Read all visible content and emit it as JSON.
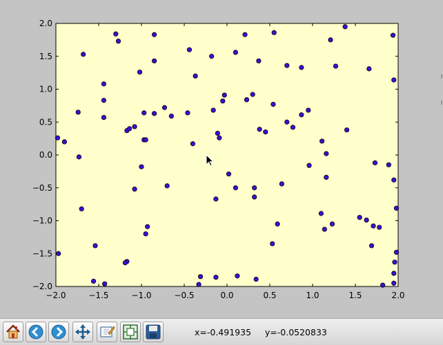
{
  "chart_data": {
    "type": "scatter",
    "xlim": [
      -2.0,
      2.0
    ],
    "ylim": [
      -2.0,
      2.0
    ],
    "x_ticks": [
      "−2.0",
      "−1.5",
      "−1.0",
      "−0.5",
      "0.0",
      "0.5",
      "1.0",
      "1.5",
      "2.0"
    ],
    "y_ticks": [
      "−2.0",
      "−1.5",
      "−1.0",
      "−0.5",
      "0.0",
      "0.5",
      "1.0",
      "1.5",
      "2.0"
    ],
    "grid": false,
    "marker_color": "#3d10d6",
    "marker_edge": "#000000",
    "background": "#ffffcc",
    "points": [
      [
        -1.3,
        1.84
      ],
      [
        -1.27,
        1.73
      ],
      [
        -0.85,
        1.83
      ],
      [
        -1.68,
        1.53
      ],
      [
        -0.44,
        1.6
      ],
      [
        -0.18,
        1.5
      ],
      [
        0.1,
        1.56
      ],
      [
        0.21,
        1.83
      ],
      [
        0.55,
        1.86
      ],
      [
        0.37,
        1.43
      ],
      [
        0.7,
        1.36
      ],
      [
        0.87,
        1.33
      ],
      [
        1.21,
        1.75
      ],
      [
        1.38,
        1.95
      ],
      [
        1.27,
        1.35
      ],
      [
        1.66,
        1.31
      ],
      [
        1.94,
        1.82
      ],
      [
        1.95,
        1.14
      ],
      [
        -0.85,
        1.43
      ],
      [
        -1.02,
        1.26
      ],
      [
        -0.37,
        1.2
      ],
      [
        -1.44,
        1.08
      ],
      [
        -1.44,
        0.83
      ],
      [
        -1.44,
        0.57
      ],
      [
        -1.74,
        0.65
      ],
      [
        -0.97,
        0.64
      ],
      [
        -0.85,
        0.63
      ],
      [
        -0.73,
        0.72
      ],
      [
        -0.65,
        0.59
      ],
      [
        -0.46,
        0.64
      ],
      [
        -0.16,
        0.68
      ],
      [
        -0.05,
        0.82
      ],
      [
        -0.03,
        0.91
      ],
      [
        0.23,
        0.84
      ],
      [
        0.3,
        0.92
      ],
      [
        0.54,
        0.77
      ],
      [
        0.95,
        0.68
      ],
      [
        0.87,
        0.61
      ],
      [
        0.7,
        0.5
      ],
      [
        0.77,
        0.42
      ],
      [
        1.4,
        0.38
      ],
      [
        0.38,
        0.39
      ],
      [
        0.45,
        0.35
      ],
      [
        -0.11,
        0.33
      ],
      [
        -0.09,
        0.26
      ],
      [
        -1.17,
        0.37
      ],
      [
        -1.14,
        0.4
      ],
      [
        -1.08,
        0.43
      ],
      [
        -1.98,
        0.26
      ],
      [
        -1.9,
        0.2
      ],
      [
        -0.97,
        0.23
      ],
      [
        -0.95,
        0.23
      ],
      [
        -0.4,
        0.17
      ],
      [
        1.11,
        0.21
      ],
      [
        1.16,
        0.02
      ],
      [
        -1.73,
        -0.03
      ],
      [
        -1.0,
        -0.18
      ],
      [
        0.96,
        -0.16
      ],
      [
        1.73,
        -0.12
      ],
      [
        1.89,
        -0.15
      ],
      [
        0.02,
        -0.29
      ],
      [
        1.16,
        -0.34
      ],
      [
        1.95,
        -0.38
      ],
      [
        -0.7,
        -0.47
      ],
      [
        0.1,
        -0.5
      ],
      [
        0.64,
        -0.44
      ],
      [
        0.32,
        -0.5
      ],
      [
        -1.08,
        -0.52
      ],
      [
        0.32,
        -0.64
      ],
      [
        -0.13,
        -0.67
      ],
      [
        -1.7,
        -0.82
      ],
      [
        1.98,
        -0.81
      ],
      [
        1.1,
        -0.89
      ],
      [
        1.55,
        -0.95
      ],
      [
        1.63,
        -0.99
      ],
      [
        1.71,
        -1.08
      ],
      [
        1.78,
        -1.1
      ],
      [
        0.59,
        -1.05
      ],
      [
        1.23,
        -1.05
      ],
      [
        1.14,
        -1.13
      ],
      [
        -0.93,
        -1.09
      ],
      [
        -0.95,
        -1.2
      ],
      [
        0.53,
        -1.35
      ],
      [
        1.69,
        -1.38
      ],
      [
        -1.54,
        -1.38
      ],
      [
        -1.97,
        -1.5
      ],
      [
        1.98,
        -1.48
      ],
      [
        1.96,
        -1.63
      ],
      [
        -1.17,
        -1.62
      ],
      [
        -1.19,
        -1.64
      ],
      [
        -0.31,
        -1.85
      ],
      [
        -0.13,
        -1.86
      ],
      [
        0.12,
        -1.84
      ],
      [
        0.34,
        -1.89
      ],
      [
        -1.56,
        -1.92
      ],
      [
        -1.43,
        -1.96
      ],
      [
        -0.33,
        -1.97
      ],
      [
        1.82,
        -1.98
      ],
      [
        1.95,
        -1.95
      ],
      [
        1.95,
        -1.8
      ]
    ]
  },
  "cursor_icon": "arrow-cursor-icon",
  "toolbar": {
    "buttons": [
      {
        "name": "home-button",
        "icon": "home-icon"
      },
      {
        "name": "back-button",
        "icon": "back-arrow-icon"
      },
      {
        "name": "forward-button",
        "icon": "forward-arrow-icon"
      },
      {
        "name": "pan-button",
        "icon": "pan-icon"
      },
      {
        "name": "zoom-button",
        "icon": "zoom-rect-icon"
      },
      {
        "name": "subplots-button",
        "icon": "subplots-icon"
      },
      {
        "name": "save-button",
        "icon": "save-icon"
      }
    ],
    "coords_text": "x=-0.491935     y=-0.0520833"
  }
}
